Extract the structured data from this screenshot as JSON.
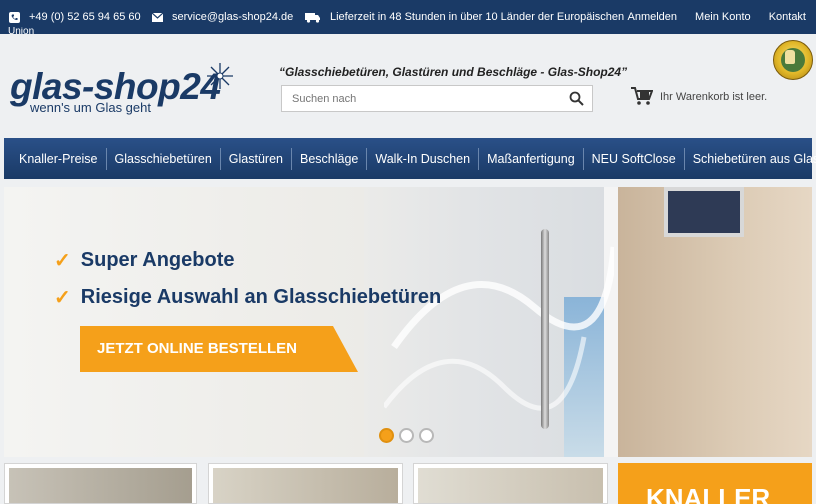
{
  "topbar": {
    "phone": "+49 (0) 52 65 94 65 60",
    "email": "service@glas-shop24.de",
    "delivery": "Lieferzeit in 48 Stunden in über 10 Länder der Europäischen",
    "delivery_cont": "Union",
    "links": [
      "Anmelden",
      "Mein Konto",
      "Kontakt"
    ]
  },
  "header": {
    "logo_main": "glas-shop24",
    "logo_sub": "wenn's um Glas geht",
    "tagline": "“Glasschiebetüren, Glastüren und Beschläge - Glas-Shop24”",
    "cart_text": "Ihr Warenkorb ist leer."
  },
  "search": {
    "placeholder": "Suchen nach"
  },
  "nav": {
    "items": [
      "Knaller-Preise",
      "Glasschiebetüren",
      "Glastüren",
      "Beschläge",
      "Walk-In Duschen",
      "Maßanfertigung",
      "NEU SoftClose",
      "Schiebetüren aus Glas"
    ]
  },
  "hero": {
    "line1": "Super Angebote",
    "line2": "Riesige Auswahl an Glasschiebetüren",
    "cta": "JETZT ONLINE BESTELLEN",
    "slide_count": 3,
    "active_slide": 1
  },
  "promo": {
    "knaller": "KNALLER"
  },
  "colors": {
    "navy": "#1a3a66",
    "orange": "#f5a01a",
    "background": "#eef0f2"
  },
  "icons": [
    "phone-icon",
    "mail-icon",
    "truck-icon",
    "logo-star-icon",
    "search-icon",
    "cart-icon",
    "check-icon",
    "seal-badge"
  ]
}
